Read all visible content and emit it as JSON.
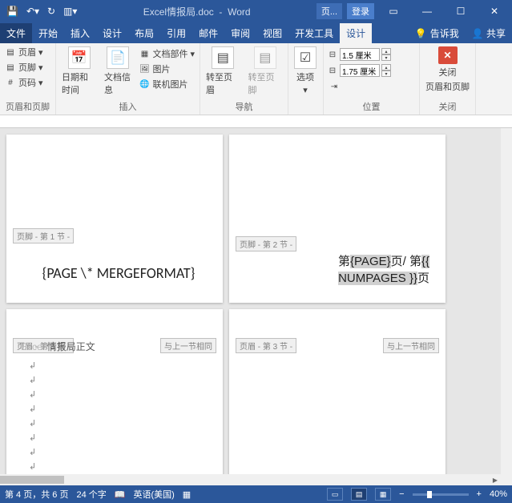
{
  "title": {
    "document_name": "Excel情报局.doc",
    "app_name": "Word"
  },
  "titlebar": {
    "context_tab": "页...",
    "login": "登录"
  },
  "tabs": {
    "file": "文件",
    "home": "开始",
    "insert": "插入",
    "design": "设计",
    "layout": "布局",
    "references": "引用",
    "mailings": "邮件",
    "review": "审阅",
    "view": "视图",
    "devtools": "开发工具",
    "hf_design": "设计",
    "tell_me": "告诉我",
    "share": "共享"
  },
  "ribbon": {
    "g1": {
      "header": "页眉",
      "footer": "页脚",
      "pagenum": "页码",
      "label": "页眉和页脚"
    },
    "g2": {
      "datetime": "日期和时间",
      "docinfo": "文档信息",
      "quickparts": "文档部件",
      "picture": "图片",
      "online_pic": "联机图片",
      "label": "插入"
    },
    "g3": {
      "goto_header": "转至页眉",
      "goto_footer": "转至页脚",
      "label": "导航"
    },
    "g4": {
      "options": "选项",
      "label": ""
    },
    "g5": {
      "top_value": "1.5 厘米",
      "bottom_value": "1.75 厘米",
      "label": "位置"
    },
    "g6": {
      "close": "关闭",
      "close_sub": "页眉和页脚",
      "label": "关闭"
    }
  },
  "pages": {
    "p1": {
      "tag": "页脚 - 第 1 节 -",
      "text": "{PAGE      \\* MERGEFORMAT}"
    },
    "p2": {
      "tag": "页脚 - 第 2 节 -",
      "line1_a": "第",
      "line1_b": "{PAGE}",
      "line1_c": "页/  第",
      "line1_d": "{{",
      "line2_a": "NUMPAGES  }}",
      "line2_b": "页"
    },
    "p3": {
      "tag": "页眉 - 第 3 节 -",
      "same": "与上一节相同",
      "header_text": "情报局正文"
    },
    "p4": {
      "tag": "页眉 - 第 3 节 -",
      "same": "与上一节相同"
    }
  },
  "status": {
    "page": "第 4 页，共 6 页",
    "words": "24 个字",
    "lang": "英语(美国)",
    "zoom": "40%"
  }
}
